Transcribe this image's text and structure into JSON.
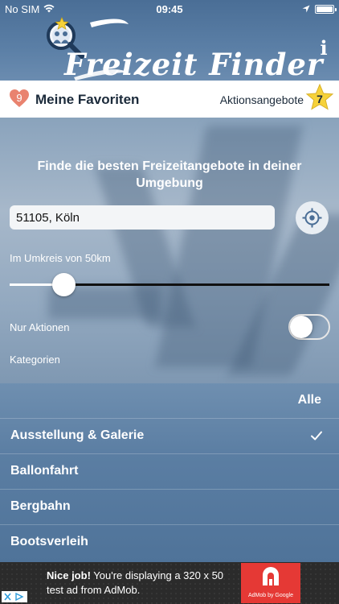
{
  "status_bar": {
    "carrier": "No SIM",
    "time": "09:45",
    "icons": [
      "wifi-icon",
      "location-arrow-icon",
      "battery-icon"
    ]
  },
  "header": {
    "logo_text": "Freizeit Finder",
    "info_label": "i",
    "colors": {
      "header_bg": "#4a6e96",
      "logo": "#ffffff"
    }
  },
  "favorites_bar": {
    "favorites_count": "9",
    "favorites_label": "Meine Favoriten",
    "actions_label": "Aktionsangebote",
    "actions_count": "7",
    "colors": {
      "heart": "#e9836f",
      "star": "#f6d23a"
    }
  },
  "search": {
    "headline": "Finde die besten Freizeitangebote in deiner Umgebung",
    "location_value": "51105, Köln",
    "radius_label": "Im Umkreis von 50km",
    "radius_slider_fraction": 0.17,
    "actions_only_label": "Nur Aktionen",
    "actions_only_enabled": false,
    "categories_label": "Kategorien"
  },
  "categories": {
    "all_label": "Alle",
    "items": [
      {
        "label": "Ausstellung & Galerie",
        "checked": true
      },
      {
        "label": "Ballonfahrt",
        "checked": false
      },
      {
        "label": "Bergbahn",
        "checked": false
      },
      {
        "label": "Bootsverleih",
        "checked": false
      }
    ]
  },
  "ad": {
    "headline": "Nice job!",
    "body": "You're displaying a 320 x 50 test ad from AdMob.",
    "caption": "AdMob by Google"
  }
}
